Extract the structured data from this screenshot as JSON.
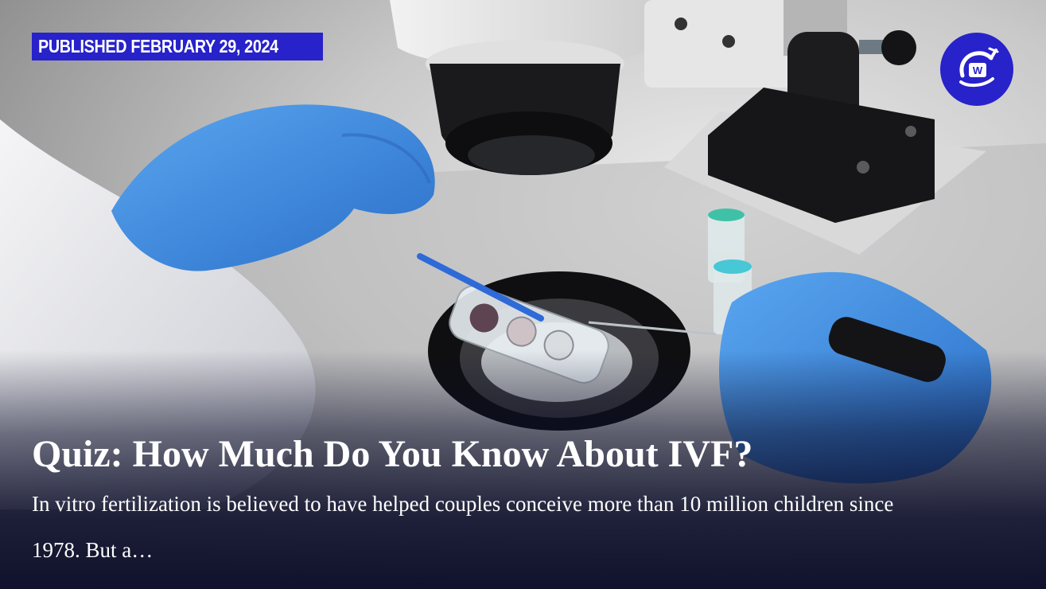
{
  "card": {
    "published_label": "PUBLISHED FEBRUARY 29, 2024",
    "title": "Quiz: How Much Do You Know About IVF?",
    "description": "In vitro fertilization is believed to have helped couples conceive more than 10 million children since 1978. But a…"
  },
  "logo": {
    "icon": "site-logo-icon",
    "letter": "W"
  },
  "hero_image": {
    "icon": "lab-microscope-ivf-photo"
  },
  "colors": {
    "accent": "#2722c9",
    "glove": "#3a8ee6",
    "overlay": "#0a0c28",
    "text": "#ffffff"
  }
}
